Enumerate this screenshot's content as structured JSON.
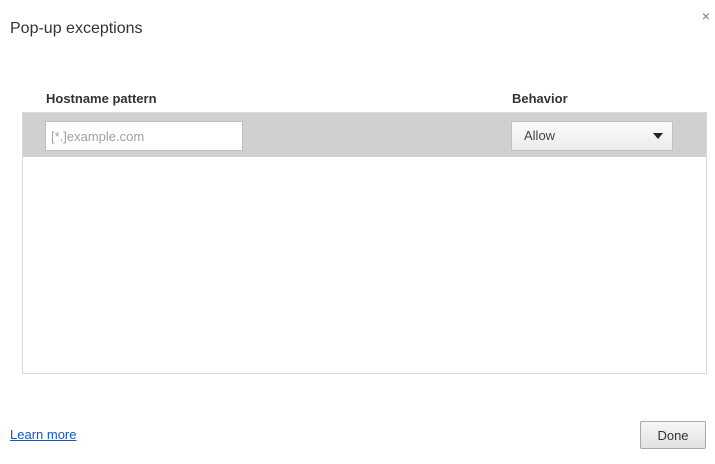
{
  "dialog": {
    "title": "Pop-up exceptions",
    "close_icon": "close-icon",
    "close_glyph": "×"
  },
  "table": {
    "headers": {
      "hostname": "Hostname pattern",
      "behavior": "Behavior"
    },
    "new_row": {
      "hostname_value": "",
      "hostname_placeholder": "[*.]example.com",
      "behavior_selected": "Allow"
    }
  },
  "footer": {
    "learn_more": "Learn more",
    "done_label": "Done"
  },
  "colors": {
    "row_highlight": "#d0d0d0",
    "link": "#1155cc"
  }
}
